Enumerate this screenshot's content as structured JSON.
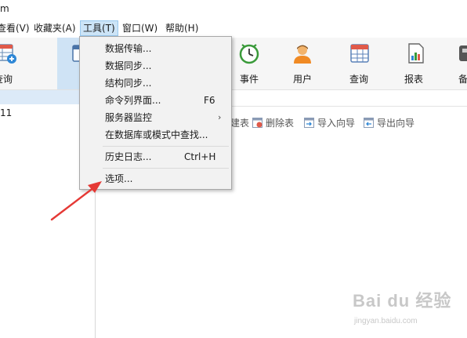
{
  "window": {
    "title": "m"
  },
  "menubar": {
    "items": [
      {
        "label": "查看(V)"
      },
      {
        "label": "收藏夹(A)"
      },
      {
        "label": "工具(T)"
      },
      {
        "label": "窗口(W)"
      },
      {
        "label": "帮助(H)"
      }
    ]
  },
  "toolbar": {
    "items": [
      {
        "label": "查询",
        "icon": "new-query-icon"
      },
      {
        "label": "",
        "icon": "table-icon"
      },
      {
        "label": "事件",
        "icon": "clock-icon"
      },
      {
        "label": "用户",
        "icon": "user-icon"
      },
      {
        "label": "查询",
        "icon": "query-grid-icon"
      },
      {
        "label": "报表",
        "icon": "report-icon"
      },
      {
        "label": "备",
        "icon": "backup-icon"
      }
    ]
  },
  "sidebar": {
    "item_label": "11"
  },
  "object_toolbar": {
    "items": [
      {
        "label": "建表",
        "icon": "design-table-icon"
      },
      {
        "label": "删除表",
        "icon": "delete-table-icon"
      },
      {
        "label": "导入向导",
        "icon": "import-icon"
      },
      {
        "label": "导出向导",
        "icon": "export-icon"
      }
    ]
  },
  "tools_menu": {
    "items": [
      {
        "label": "数据传输...",
        "shortcut": "",
        "submenu": false
      },
      {
        "label": "数据同步...",
        "shortcut": "",
        "submenu": false
      },
      {
        "label": "结构同步...",
        "shortcut": "",
        "submenu": false
      },
      {
        "label": "命令列界面...",
        "shortcut": "F6",
        "submenu": false
      },
      {
        "label": "服务器监控",
        "shortcut": "",
        "submenu": true
      },
      {
        "label": "在数据库或模式中查找...",
        "shortcut": "",
        "submenu": false
      },
      {
        "label": "历史日志...",
        "shortcut": "Ctrl+H",
        "submenu": false
      },
      {
        "label": "选项...",
        "shortcut": "",
        "submenu": false
      }
    ],
    "submenu_arrow": "›"
  },
  "watermark": {
    "brand": "Bai du 经验",
    "url": "jingyan.baidu.com"
  },
  "colors": {
    "menu_highlight": "#cce4f7",
    "annotation_arrow": "#e53935",
    "selection": "#dceaf8"
  }
}
